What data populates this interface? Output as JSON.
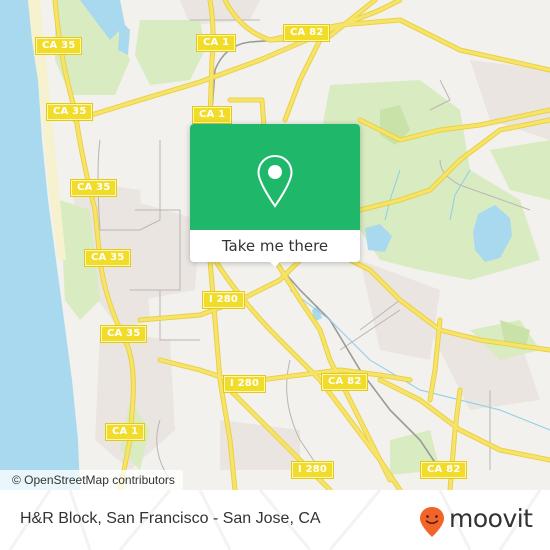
{
  "map": {
    "attribution": "© OpenStreetMap contributors",
    "colors": {
      "water": "#a9d9ee",
      "land": "#f2f1ed",
      "park": "#d9ebc1",
      "park_dark": "#c8e2a8",
      "urban": "#ebe5e2",
      "road": "#f6e36a",
      "road_edge": "#e9cf3e",
      "beach": "#f6f1cf",
      "rail": "#9a9a9a",
      "minor": "#b9b6b2"
    },
    "shields": [
      {
        "label": "CA 35",
        "name": "shield-ca35-1"
      },
      {
        "label": "CA 1",
        "name": "shield-ca1-1"
      },
      {
        "label": "CA 82",
        "name": "shield-ca82-1"
      },
      {
        "label": "CA 35",
        "name": "shield-ca35-2"
      },
      {
        "label": "CA 1",
        "name": "shield-ca1-2"
      },
      {
        "label": "CA 35",
        "name": "shield-ca35-3"
      },
      {
        "label": "CA 35",
        "name": "shield-ca35-4"
      },
      {
        "label": "I 280",
        "name": "shield-i280-1"
      },
      {
        "label": "CA 35",
        "name": "shield-ca35-5"
      },
      {
        "label": "I 280",
        "name": "shield-i280-2"
      },
      {
        "label": "CA 82",
        "name": "shield-ca82-2"
      },
      {
        "label": "CA 1",
        "name": "shield-ca1-3"
      },
      {
        "label": "I 280",
        "name": "shield-i280-3"
      },
      {
        "label": "CA 82",
        "name": "shield-ca82-3"
      }
    ]
  },
  "popup": {
    "icon": "location-pin-icon",
    "button_label": "Take me there",
    "accent": "#1fb86a"
  },
  "footer": {
    "place_title": "H&R Block, San Francisco - San Jose, CA",
    "brand": {
      "name": "moovit",
      "logo_icon": "moovit-smiley-pin-icon",
      "color": "#f2642a"
    }
  }
}
